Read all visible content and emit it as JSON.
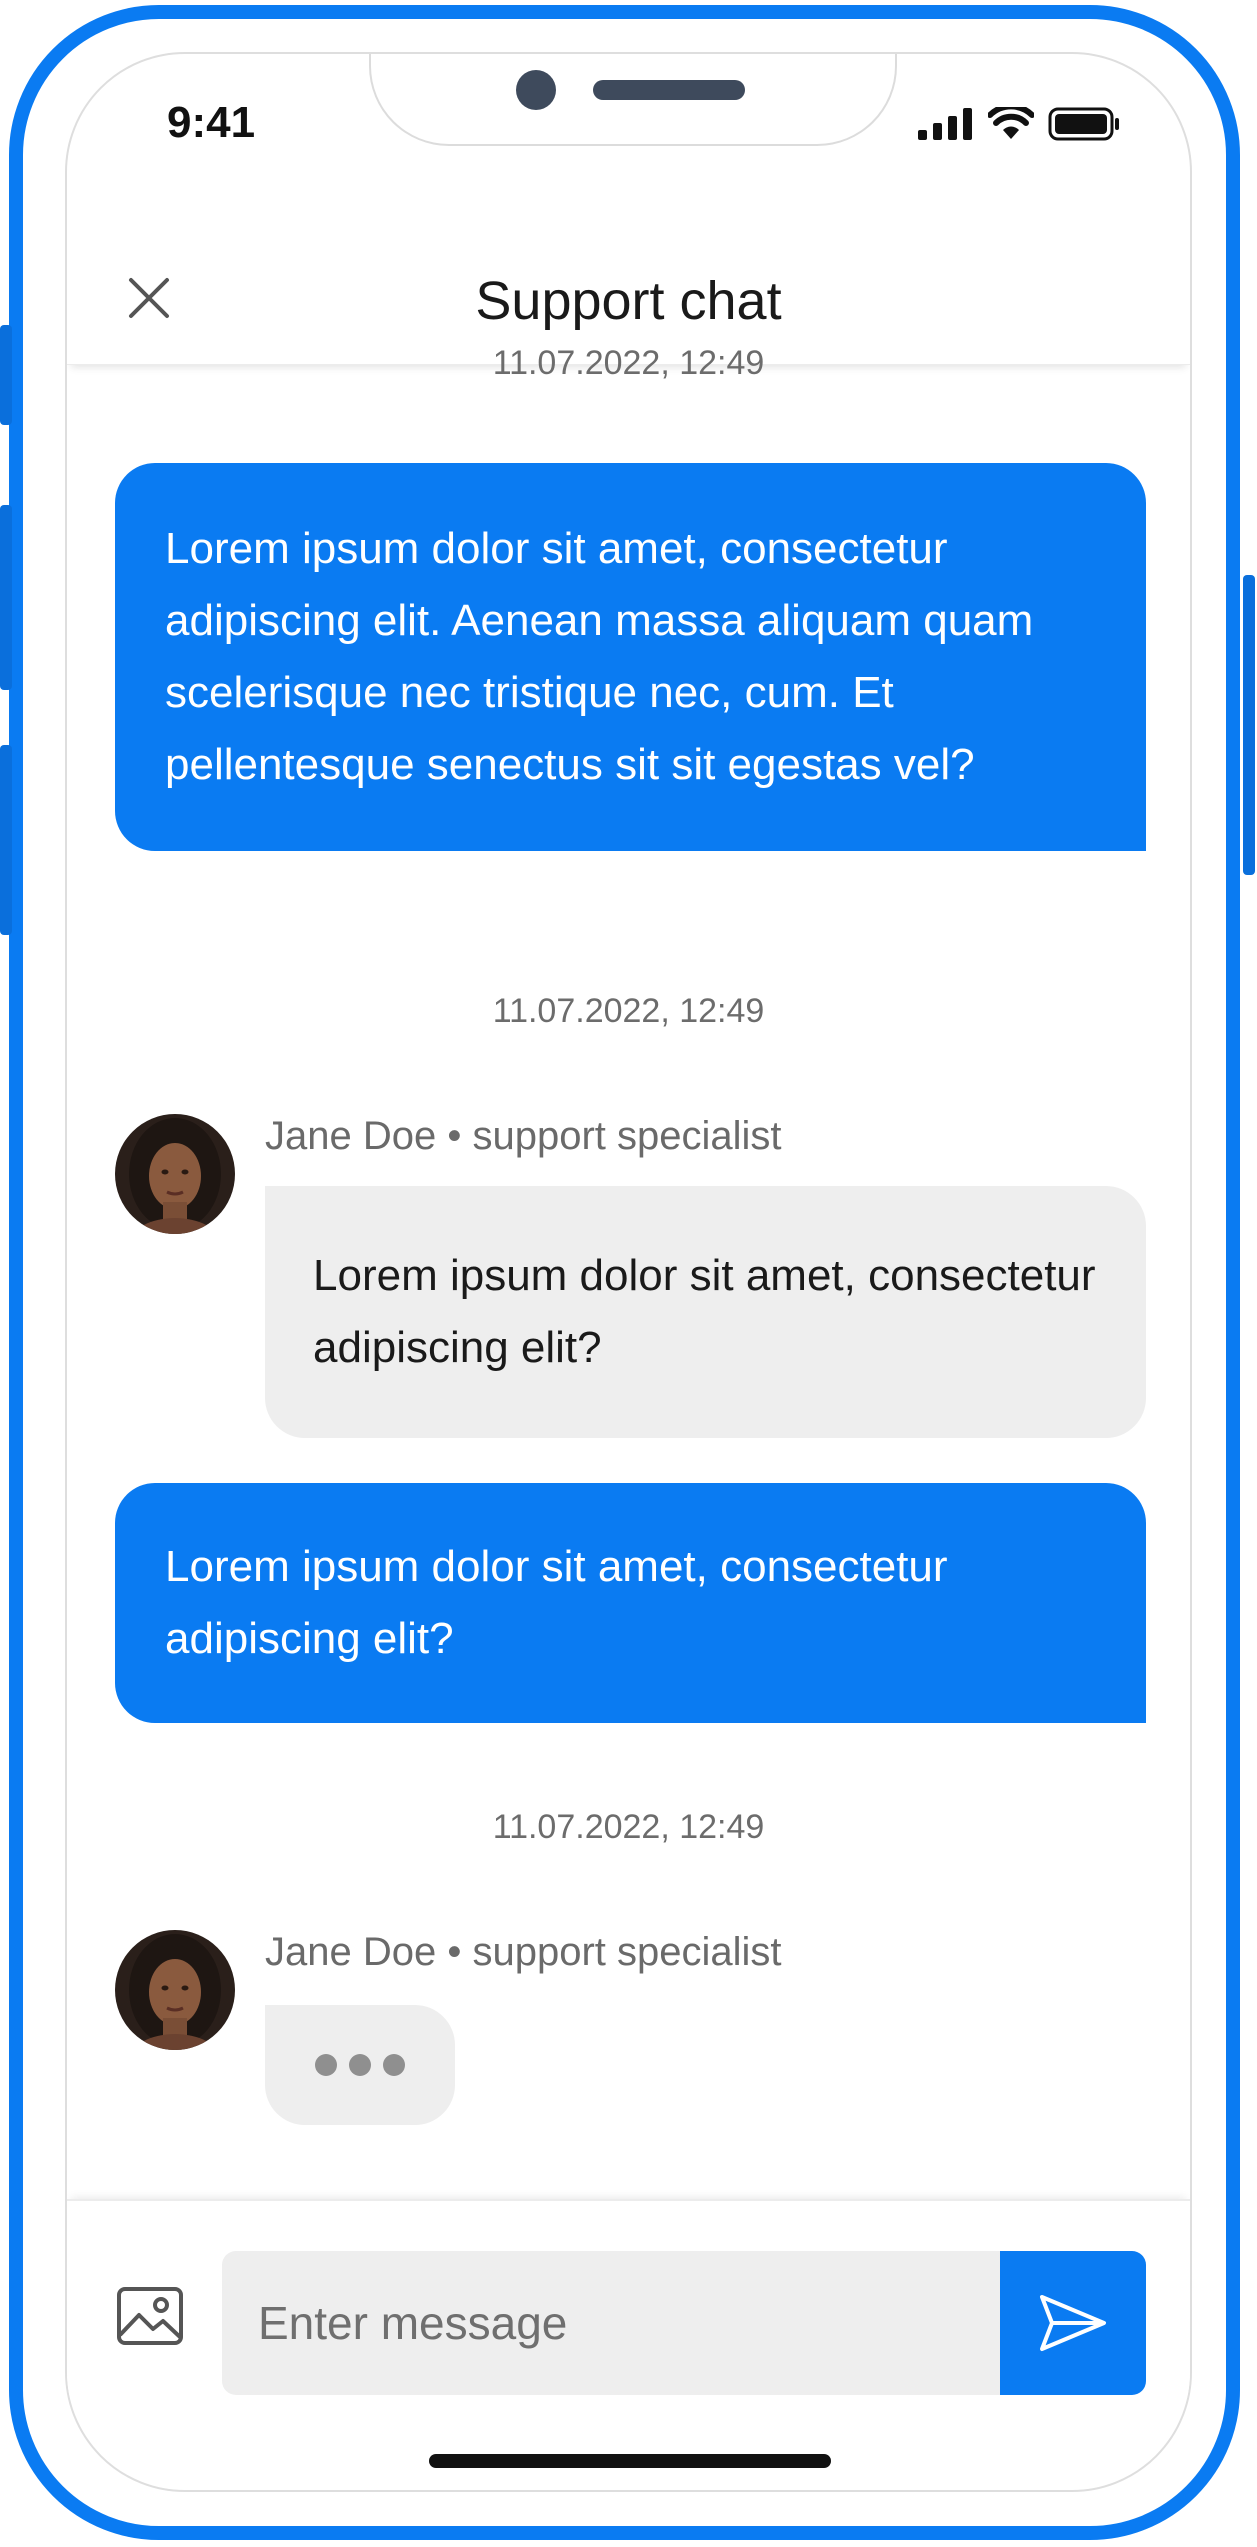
{
  "status_bar": {
    "time": "9:41"
  },
  "header": {
    "title": "Support chat"
  },
  "messages": [
    {
      "timestamp": "11.07.2022, 12:49",
      "text": "Lorem ipsum dolor sit amet, consectetur adipiscing elit. Aenean massa aliquam quam scelerisque nec tristique nec, cum. Et pellentesque senectus sit sit egestas vel?"
    },
    {
      "timestamp": "11.07.2022, 12:49",
      "sender": "Jane Doe • support specialist",
      "text": "Lorem ipsum dolor sit amet, consectetur adipiscing elit?"
    },
    {
      "text": "Lorem ipsum dolor sit amet, consectetur adipiscing elit?"
    },
    {
      "timestamp": "11.07.2022, 12:49",
      "sender": "Jane Doe • support specialist",
      "typing": true
    }
  ],
  "composer": {
    "placeholder": "Enter message"
  },
  "colors": {
    "accent": "#0a7bf2",
    "incoming_bubble": "#eeeeee",
    "muted_text": "#6c6c6c"
  },
  "icons": [
    "close-icon",
    "image-icon",
    "send-icon",
    "signal-icon",
    "wifi-icon",
    "battery-icon"
  ]
}
